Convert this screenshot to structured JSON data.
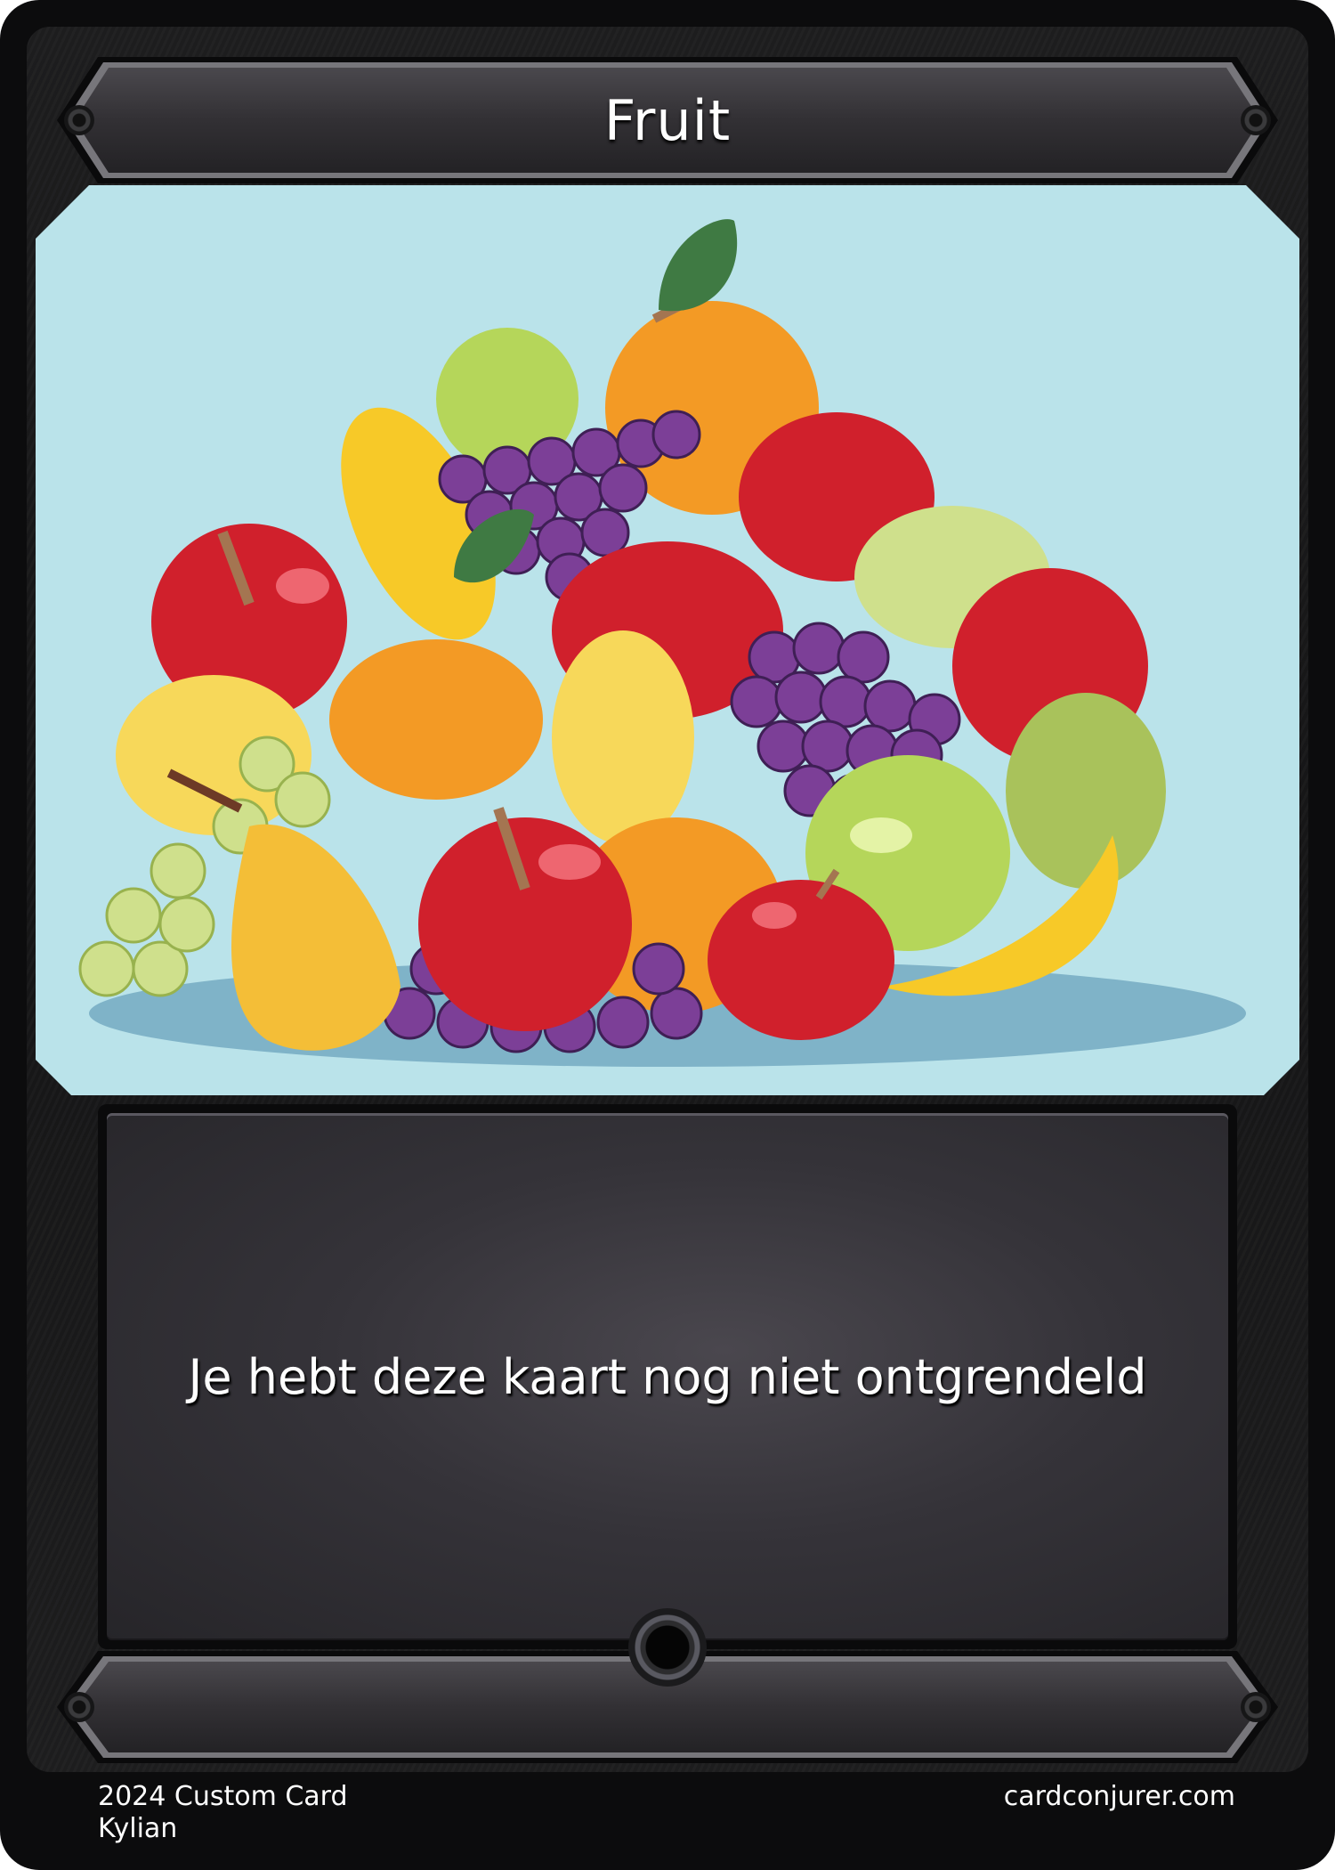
{
  "card": {
    "title": "Fruit",
    "rules_text": "Je hebt deze kaart nog niet ontgrendeld",
    "art_icon": "fruit-pile-illustration",
    "footer": {
      "year_line": "2024 Custom Card",
      "artist": "Kylian",
      "site": "cardconjurer.com"
    }
  },
  "colors": {
    "frame": "#161617",
    "art_background": "#bae3ea",
    "text": "#ffffff"
  }
}
